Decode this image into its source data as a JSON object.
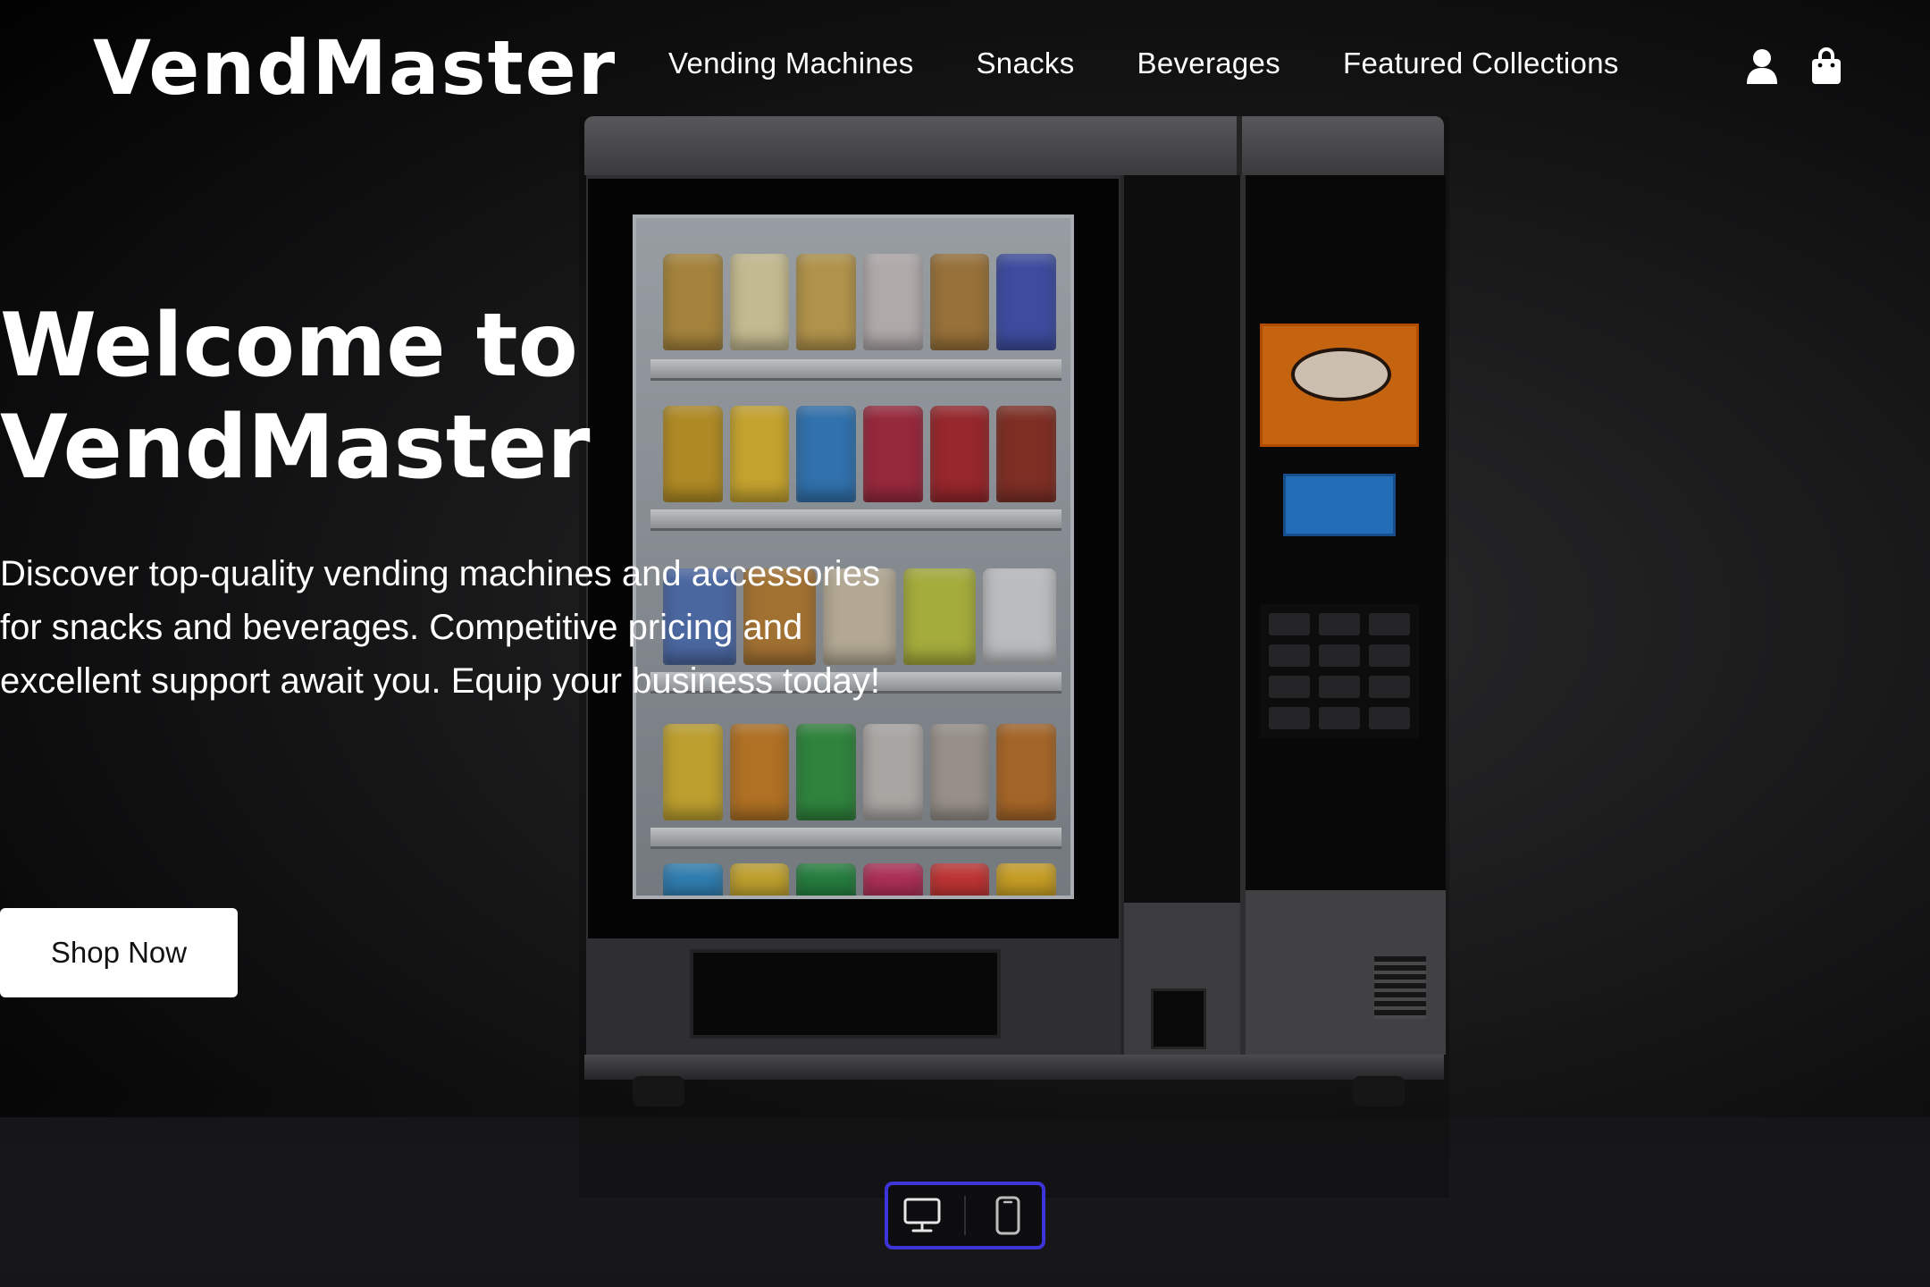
{
  "brand": {
    "name": "VendMaster"
  },
  "nav": {
    "items": [
      {
        "label": "Vending Machines"
      },
      {
        "label": "Snacks"
      },
      {
        "label": "Beverages"
      },
      {
        "label": "Featured Collections"
      }
    ],
    "icons": [
      "user-icon",
      "shopping-bag-icon"
    ]
  },
  "hero": {
    "title": "Welcome to VendMaster",
    "description": "Discover top-quality vending machines and accessories for snacks and beverages. Competitive pricing and excellent support await you. Equip your business today!",
    "cta_label": "Shop Now"
  },
  "device_toggle": {
    "options": [
      "desktop-icon",
      "mobile-icon"
    ],
    "selected": "desktop-icon",
    "accent_color": "#3d35d8"
  },
  "colors": {
    "background": "#000000",
    "text": "#ffffff",
    "button_bg": "#ffffff",
    "button_text": "#111111"
  }
}
